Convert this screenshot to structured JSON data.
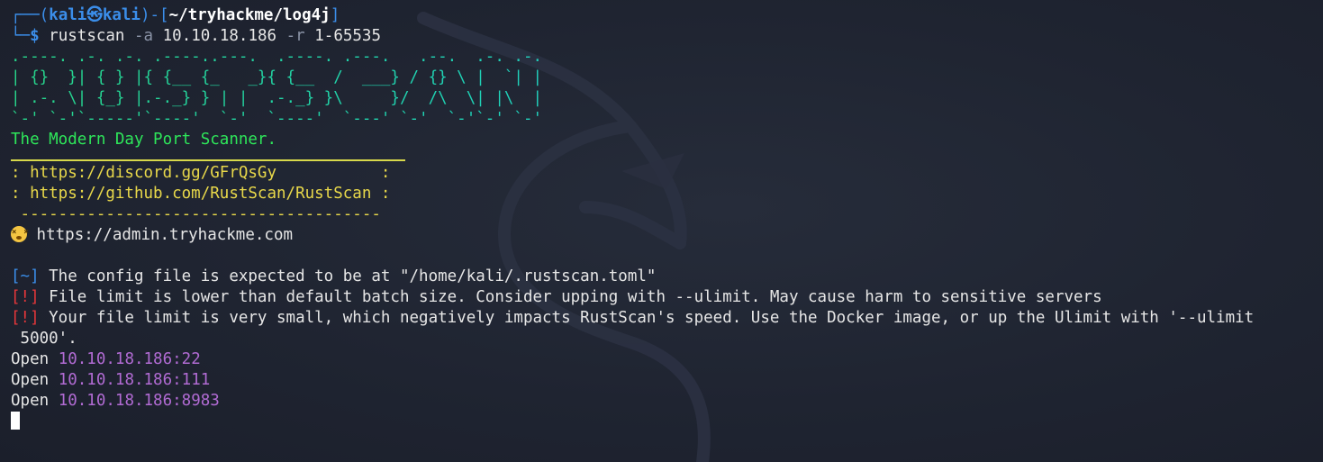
{
  "prompt": {
    "corner_top": "┌──(",
    "user": "kali",
    "at_symbol": "㉿",
    "host": "kali",
    "sep": ")-[",
    "path": "~/tryhackme/log4j",
    "close": "]",
    "corner_bottom": "└─",
    "dollar": "$",
    "command": "rustscan",
    "flag_a": "-a",
    "target": "10.10.18.186",
    "flag_r": "-r",
    "range": "1-65535"
  },
  "banner": {
    "ascii": [
      ".----. .-. .-. .----..---.  .----. .---.   .--.  .-. .-.",
      "| {}  }| { } |{ {__ {_   _}{ {__  /  ___} / {} \\ |  `| |",
      "| .-. \\| {_} |.-._} } | |  .-._} }\\     }/  /\\  \\| |\\  |",
      "`-' `-'`-----'`----'  `-'  `----'  `---' `-'  `-'`-' `-'"
    ],
    "tagline": "The Modern Day Port Scanner.",
    "discord": ": https://discord.gg/GFrQsGy           :",
    "github": ": https://github.com/RustScan/RustScan :",
    "dashes": " --------------------------------------",
    "joke": "https://admin.tryhackme.com"
  },
  "messages": [
    {
      "tag": "[~]",
      "tag_color": "#3b8eea",
      "text": " The config file is expected to be at \"/home/kali/.rustscan.toml\""
    },
    {
      "tag": "[!]",
      "tag_color": "#e5373a",
      "text": " File limit is lower than default batch size. Consider upping with --ulimit. May cause harm to sensitive servers"
    },
    {
      "tag": "[!]",
      "tag_color": "#e5373a",
      "text": " Your file limit is very small, which negatively impacts RustScan's speed. Use the Docker image, or up the Ulimit with '--ulimit"
    }
  ],
  "wrap_continuation": " 5000'.",
  "open_ports": [
    {
      "label": "Open",
      "address": "10.10.18.186:22"
    },
    {
      "label": "Open",
      "address": "10.10.18.186:111"
    },
    {
      "label": "Open",
      "address": "10.10.18.186:8983"
    }
  ],
  "icons": {
    "joke_emoji": "dizzy-face-icon",
    "cursor": "block-cursor",
    "watermark": "kali-dragon-icon"
  },
  "colors": {
    "background": "#1e2330",
    "prompt_blue": "#3b8eea",
    "port_purple": "#b16bd3",
    "tagline_green": "#2ee65a",
    "links_yellow": "#e8d84a",
    "warning_red": "#e5373a"
  }
}
